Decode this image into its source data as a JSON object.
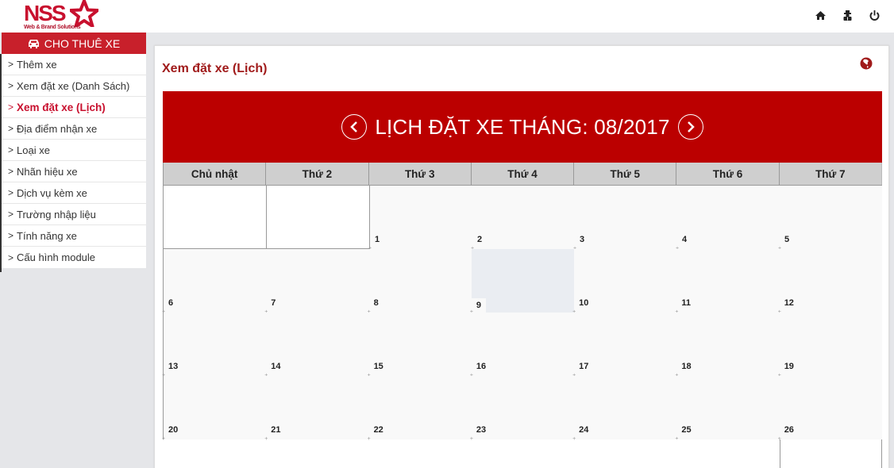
{
  "brand": {
    "logo_text": "NSS",
    "logo_tagline": "Web & Brand Solutions",
    "primary_color": "#c8202b",
    "calendar_color": "#bb0000",
    "title_color": "#a01a1a"
  },
  "topbar": {
    "icons": [
      {
        "name": "home-icon",
        "label": "Trang chủ"
      },
      {
        "name": "user-icon",
        "label": "Tài khoản"
      },
      {
        "name": "power-icon",
        "label": "Đăng xuất"
      }
    ]
  },
  "sidebar": {
    "header": "CHO THUÊ XE",
    "header_icon": "car-icon",
    "items": [
      {
        "label": "Thêm xe",
        "active": false
      },
      {
        "label": "Xem đặt xe (Danh Sách)",
        "active": false
      },
      {
        "label": "Xem đặt xe (Lịch)",
        "active": true
      },
      {
        "label": "Địa điểm nhận xe",
        "active": false
      },
      {
        "label": "Loại xe",
        "active": false
      },
      {
        "label": "Nhãn hiệu xe",
        "active": false
      },
      {
        "label": "Dịch vụ kèm xe",
        "active": false
      },
      {
        "label": "Trường nhập liệu",
        "active": false
      },
      {
        "label": "Tính năng xe",
        "active": false
      },
      {
        "label": "Cấu hình module",
        "active": false
      }
    ]
  },
  "panel": {
    "title": "Xem đặt xe (Lịch)",
    "corner_icon": "globe-icon"
  },
  "calendar": {
    "title": "LỊCH ĐẶT XE THÁNG: 08/2017",
    "prev_icon": "chevron-left-icon",
    "next_icon": "chevron-right-icon",
    "weekdays": [
      "Chủ nhật",
      "Thứ 2",
      "Thứ 3",
      "Thứ 4",
      "Thứ 5",
      "Thứ 6",
      "Thứ 7"
    ],
    "weeks": [
      [
        "",
        "",
        "1",
        "2",
        "3",
        "4",
        "5"
      ],
      [
        "6",
        "7",
        "8",
        "9",
        "10",
        "11",
        "12"
      ],
      [
        "13",
        "14",
        "15",
        "16",
        "17",
        "18",
        "19"
      ],
      [
        "20",
        "21",
        "22",
        "23",
        "24",
        "25",
        "26"
      ]
    ],
    "highlighted_day": "9"
  }
}
